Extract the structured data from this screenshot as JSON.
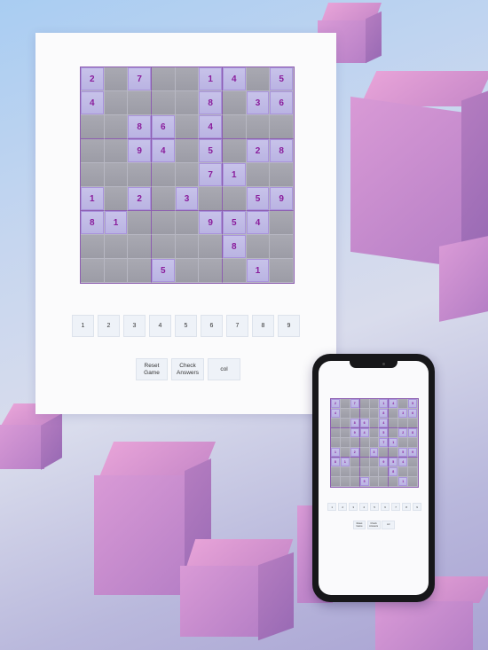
{
  "background": {
    "accent": "#c889c9"
  },
  "board": {
    "rows": [
      [
        "2",
        "",
        "7",
        "",
        "",
        "1",
        "4",
        "",
        "5"
      ],
      [
        "4",
        "",
        "",
        "",
        "",
        "8",
        "",
        "3",
        "6"
      ],
      [
        "",
        "",
        "8",
        "6",
        "",
        "4",
        "",
        "",
        ""
      ],
      [
        "",
        "",
        "9",
        "4",
        "",
        "5",
        "",
        "2",
        "8"
      ],
      [
        "",
        "",
        "",
        "",
        "",
        "7",
        "1",
        "",
        ""
      ],
      [
        "1",
        "",
        "2",
        "",
        "3",
        "",
        "",
        "5",
        "9"
      ],
      [
        "8",
        "1",
        "",
        "",
        "",
        "9",
        "5",
        "4",
        ""
      ],
      [
        "",
        "",
        "",
        "",
        "",
        "",
        "8",
        "",
        ""
      ],
      [
        "",
        "",
        "",
        "5",
        "",
        "",
        "",
        "1",
        ""
      ]
    ],
    "given_color": "#8a1c9c"
  },
  "numpad": {
    "keys": [
      "1",
      "2",
      "3",
      "4",
      "5",
      "6",
      "7",
      "8",
      "9"
    ]
  },
  "actions": {
    "reset_label": "Reset\nGame",
    "check_label": "Check\nAnswers",
    "col_label": "col"
  }
}
